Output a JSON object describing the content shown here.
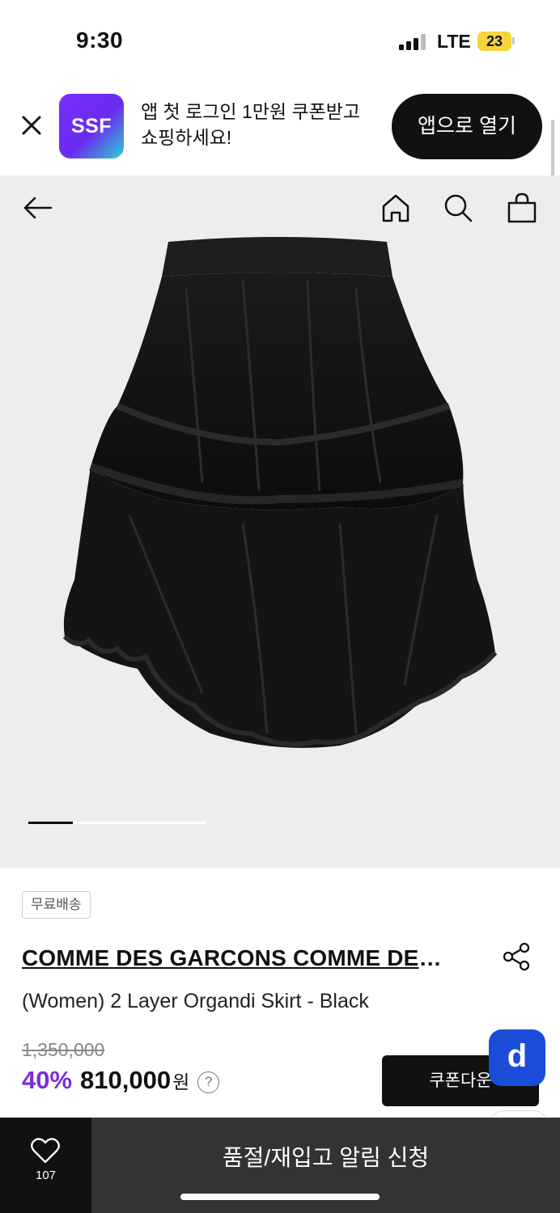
{
  "status_bar": {
    "time": "9:30",
    "network": "LTE",
    "battery": "23"
  },
  "app_banner": {
    "logo_text": "SSF",
    "message": "앱 첫 로그인 1만원 쿠폰받고 쇼핑하세요!",
    "open_button": "앱으로 열기",
    "close_icon": "close-icon"
  },
  "product_image": {
    "nav_icons": [
      "back-arrow-icon",
      "home-icon",
      "search-icon",
      "shopping-bag-icon"
    ],
    "carousel_position": 0.25
  },
  "product": {
    "badge": "무료배송",
    "brand": "COMME DES GARCONS COMME DES GARCONS",
    "name": "(Women) 2 Layer Organdi Skirt - Black",
    "original_price": "1,350,000",
    "discount": "40%",
    "sale_price": "810,000",
    "currency": "원",
    "help_mark": "?",
    "coupon_button": "쿠폰다운",
    "fab_label": "d"
  },
  "bottom_bar": {
    "wishlist_count": "107",
    "restock_button": "품절/재입고 알림 신청"
  },
  "colors": {
    "accent_purple": "#7a2ce0",
    "fab_blue": "#1a4ed8",
    "battery_yellow": "#f7d43a",
    "image_bg": "#eceded"
  }
}
